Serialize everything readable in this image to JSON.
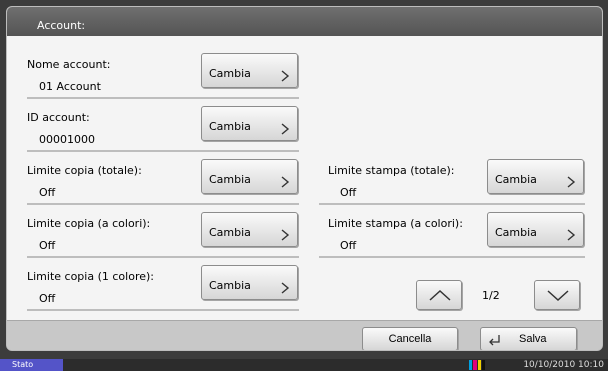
{
  "screen_title": "Account:",
  "fields": {
    "nome_account": {
      "label": "Nome account:",
      "value": "01 Account",
      "button": "Cambia"
    },
    "id_account": {
      "label": "ID account:",
      "value": "00001000",
      "button": "Cambia"
    },
    "limite_copia_totale": {
      "label": "Limite copia (totale):",
      "value": "Off",
      "button": "Cambia"
    },
    "limite_stampa_totale": {
      "label": "Limite stampa (totale):",
      "value": "Off",
      "button": "Cambia"
    },
    "limite_copia_colori": {
      "label": "Limite copia (a colori):",
      "value": "Off",
      "button": "Cambia"
    },
    "limite_stampa_colori": {
      "label": "Limite stampa (a colori):",
      "value": "Off",
      "button": "Cambia"
    },
    "limite_copia_1colore": {
      "label": "Limite copia (1 colore):",
      "value": "Off",
      "button": "Cambia"
    }
  },
  "pagination": {
    "indicator": "1/2"
  },
  "footer": {
    "cancel_label": "Cancella",
    "save_label": "Salva"
  },
  "status_bar": {
    "label": "Stato",
    "datetime": "10/10/2010  10:10"
  },
  "colors": {
    "accent": "#5454c8",
    "toner": [
      "#00a0e0",
      "#e0007a",
      "#f0d000",
      "#111111"
    ]
  },
  "icons": {
    "button_chevron": "chevron-right-icon",
    "page_up": "chevron-up-icon",
    "page_down": "chevron-down-icon",
    "save": "enter-icon",
    "toner": "toner-level-icon"
  }
}
